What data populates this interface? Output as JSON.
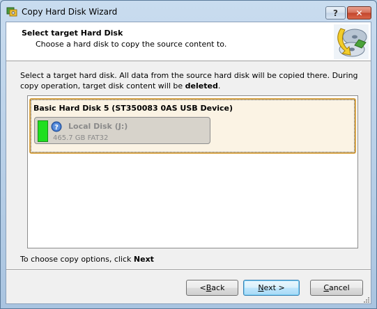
{
  "window": {
    "title": "Copy Hard Disk Wizard",
    "help_label": "?",
    "close_label": "✕"
  },
  "header": {
    "title": "Select target Hard Disk",
    "subtitle": "Choose a hard disk to copy the source content to."
  },
  "description": {
    "text": "Select a target hard disk. All data from the source hard disk will be copied there. During copy operation, target disk content will be ",
    "emphasis": "deleted",
    "end": "."
  },
  "disk": {
    "title": "Basic Hard Disk 5 (ST350083 0AS USB Device)",
    "partition": {
      "name": "Local Disk (J:)",
      "info": "465.7 GB FAT32",
      "icon": "question-icon",
      "usage_fraction": 1.0,
      "bar_color": "#1fdf1f"
    }
  },
  "hint": {
    "text": "To choose copy options, click ",
    "bold": "Next"
  },
  "buttons": {
    "back_prefix": "< ",
    "back_key": "B",
    "back_rest": "ack",
    "next_key": "N",
    "next_rest": "ext >",
    "cancel_key": "C",
    "cancel_rest": "ancel"
  }
}
